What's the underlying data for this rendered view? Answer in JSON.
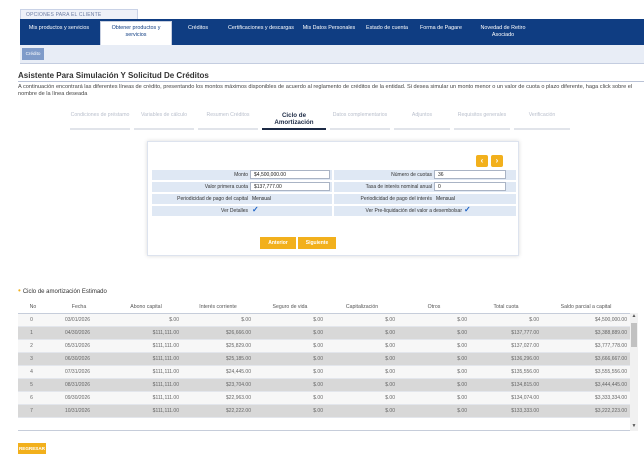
{
  "topbar": {
    "label": "OPCIONES PARA EL CLIENTE"
  },
  "nav": {
    "items": [
      {
        "label": "Mis productos y servicios"
      },
      {
        "label": "Obtener productos y servicios"
      },
      {
        "label": "Créditos"
      },
      {
        "label": "Certificaciones y descargas"
      },
      {
        "label": "Mis Datos Personales"
      },
      {
        "label": "Estado de cuenta"
      },
      {
        "label": "Forma de Pagare"
      },
      {
        "label": "Novedad de Retiro Asociado"
      }
    ]
  },
  "subnav": {
    "tab_label": "Crédito"
  },
  "page": {
    "title": "Asistente Para Simulación Y Solicitud De Créditos",
    "description": "A continuación encontrará las diferentes líneas de crédito, presentando los montos máximos disponibles de acuerdo al reglamento de créditos de la entidad. Si desea simular un monto menor o un valor de cuota o plazo diferente, haga click sobre el nombre de la línea deseada"
  },
  "steps": [
    {
      "label": "Condiciones de préstamo"
    },
    {
      "label": "Variables de cálculo"
    },
    {
      "label": "Resumen Créditos"
    },
    {
      "label": "Ciclo de Amortización"
    },
    {
      "label": "Datos complementarios"
    },
    {
      "label": "Adjuntos"
    },
    {
      "label": "Requisitos generales"
    },
    {
      "label": "Verificación"
    }
  ],
  "form": {
    "monto_label": "Monto",
    "monto_value": "$4,500,000.00",
    "valor_cuota_label": "Valor primera cuota",
    "valor_cuota_value": "$137,777.00",
    "periodicidad_capital_label": "Periodicidad de pago del capital",
    "periodicidad_capital_value": "Mensual",
    "ver_detalles_label": "Ver Detalles",
    "numero_cuotas_label": "Número de cuotas",
    "numero_cuotas_value": "36",
    "tasa_label": "Tasa de interés nominal anual",
    "tasa_value": "0",
    "periodicidad_interes_label": "Periodicidad de pago del interés",
    "periodicidad_interes_value": "Mensual",
    "preliquidacion_label": "Ver Pre-liquidación del valor a desembolsar",
    "anterior_button": "Anterior",
    "siguiente_button": "Siguiente",
    "check_icon": "check-icon",
    "prev_icon": "arrow-left-icon",
    "next_icon": "arrow-right-icon"
  },
  "amortization": {
    "title": "Ciclo de amortización Estimado",
    "headers": [
      "No",
      "Fecha",
      "Abono capital",
      "Interés corriente",
      "Seguro de vida",
      "Capitalización",
      "Otros",
      "Total cuota",
      "Saldo parcial a capital"
    ],
    "rows": [
      [
        "0",
        "03/01/2026",
        "$.00",
        "$.00",
        "$.00",
        "$.00",
        "$.00",
        "$.00",
        "$4,500,000.00"
      ],
      [
        "1",
        "04/30/2026",
        "$111,111.00",
        "$26,666.00",
        "$.00",
        "$.00",
        "$.00",
        "$137,777.00",
        "$3,388,889.00"
      ],
      [
        "2",
        "05/31/2026",
        "$111,111.00",
        "$25,829.00",
        "$.00",
        "$.00",
        "$.00",
        "$137,027.00",
        "$3,777,778.00"
      ],
      [
        "3",
        "06/30/2026",
        "$111,111.00",
        "$25,185.00",
        "$.00",
        "$.00",
        "$.00",
        "$136,296.00",
        "$3,666,667.00"
      ],
      [
        "4",
        "07/31/2026",
        "$111,111.00",
        "$24,445.00",
        "$.00",
        "$.00",
        "$.00",
        "$135,556.00",
        "$3,555,556.00"
      ],
      [
        "5",
        "08/31/2026",
        "$111,111.00",
        "$23,704.00",
        "$.00",
        "$.00",
        "$.00",
        "$134,815.00",
        "$3,444,445.00"
      ],
      [
        "6",
        "09/30/2026",
        "$111,111.00",
        "$22,963.00",
        "$.00",
        "$.00",
        "$.00",
        "$134,074.00",
        "$3,333,334.00"
      ],
      [
        "7",
        "10/31/2026",
        "$111,111.00",
        "$22,222.00",
        "$.00",
        "$.00",
        "$.00",
        "$133,333.00",
        "$3,222,223.00"
      ]
    ]
  },
  "return_button": "REGRESAR",
  "colors": {
    "navy": "#0f3d82",
    "accent": "#f2b01c",
    "check": "#1e63c4"
  }
}
